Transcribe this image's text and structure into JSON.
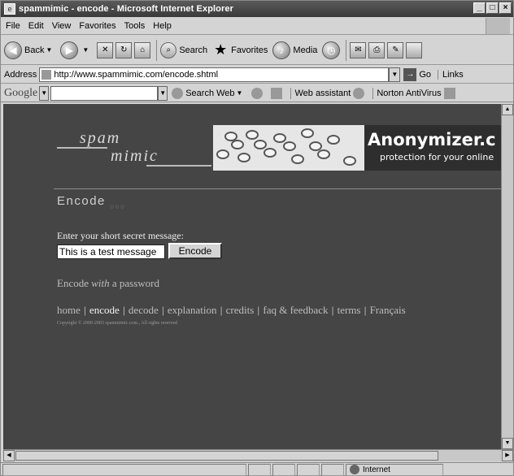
{
  "window": {
    "title": "spammimic - encode - Microsoft Internet Explorer",
    "controls": [
      "_",
      "□",
      "×"
    ]
  },
  "menu": [
    "File",
    "Edit",
    "View",
    "Favorites",
    "Tools",
    "Help"
  ],
  "toolbar": {
    "back": "Back",
    "search": "Search",
    "favorites": "Favorites",
    "media": "Media"
  },
  "address": {
    "label": "Address",
    "url": "http://www.spammimic.com/encode.shtml",
    "go": "Go",
    "links": "Links"
  },
  "googlebar": {
    "logo": "Google",
    "search_web": "Search Web",
    "web_assistant": "Web assistant",
    "norton": "Norton AntiVirus"
  },
  "page": {
    "logo_top": "spam",
    "logo_bottom": "mimic",
    "banner_brand": "Anonymizer.c",
    "banner_tag": "protection for your online",
    "heading": "Encode",
    "heading_dots": "○○○",
    "prompt": "Enter your short secret message:",
    "message_value": "This is a test message",
    "encode_button": "Encode",
    "password_pre": "Encode ",
    "password_em": "with",
    "password_post": " a password",
    "nav": [
      {
        "label": "home",
        "current": false
      },
      {
        "label": "encode",
        "current": true
      },
      {
        "label": "decode",
        "current": false
      },
      {
        "label": "explanation",
        "current": false
      },
      {
        "label": "credits",
        "current": false
      },
      {
        "label": "faq & feedback",
        "current": false
      },
      {
        "label": "terms",
        "current": false
      },
      {
        "label": "Français",
        "current": false
      }
    ],
    "copyright": "Copyright © 2000-2003 spammimic.com., All rights reserved"
  },
  "status": {
    "zone": "Internet"
  }
}
